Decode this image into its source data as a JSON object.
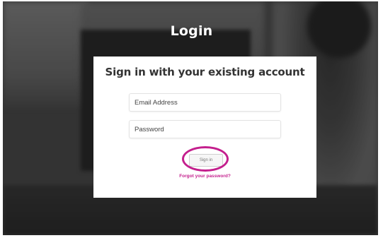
{
  "page": {
    "title": "Login"
  },
  "login_form": {
    "heading": "Sign in with your existing account",
    "email_placeholder": "Email Address",
    "password_placeholder": "Password",
    "signin_label": "Sign in",
    "forgot_password_label": "Forgot your password?"
  },
  "colors": {
    "accent": "#c41f8d",
    "heading_text": "#333333",
    "card_background": "#ffffff"
  }
}
